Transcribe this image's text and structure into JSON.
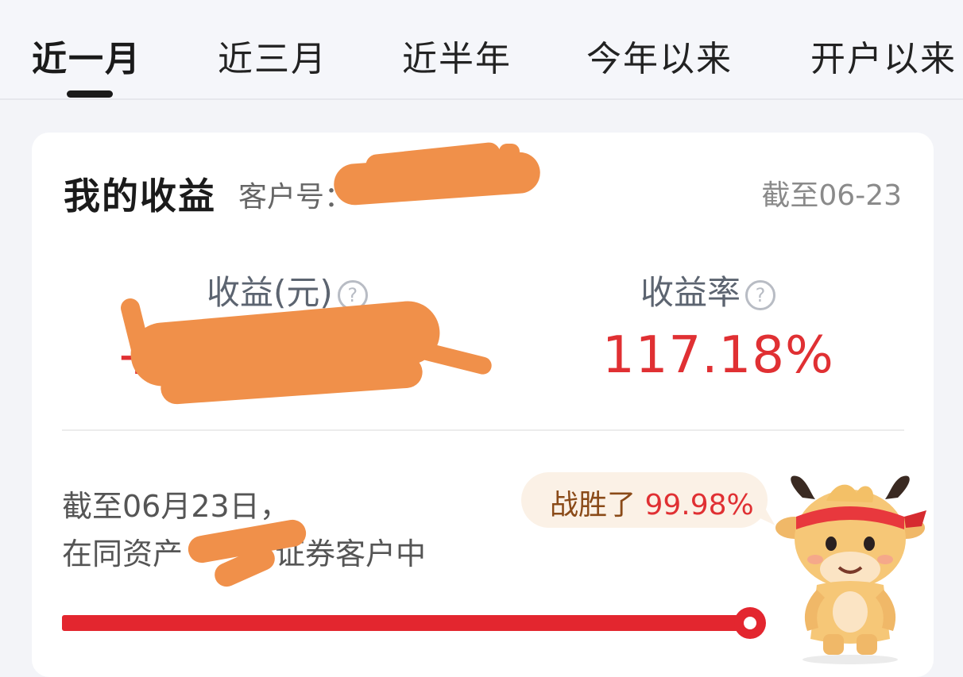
{
  "tabs": [
    {
      "label": "近一月",
      "active": true
    },
    {
      "label": "近三月",
      "active": false
    },
    {
      "label": "近半年",
      "active": false
    },
    {
      "label": "今年以来",
      "active": false
    },
    {
      "label": "开户以来",
      "active": false
    }
  ],
  "card": {
    "title": "我的收益",
    "customer_label": "客户号：",
    "as_of": "截至06-23",
    "earnings_label": "收益(元)",
    "earnings_sign": "+",
    "return_label": "收益率",
    "return_value": "117.18%",
    "rank_line1": "截至06月23日，",
    "rank_line2_prefix": "在同资产",
    "rank_line2_suffix": "证券客户中",
    "beat_prefix": "战胜了 ",
    "beat_value": "99.98%",
    "beat_fraction": 0.9998
  },
  "icons": {
    "help": "question-circle-icon",
    "mascot": "ox-mascot-icon"
  },
  "colors": {
    "accent_red": "#e3262f",
    "return_red": "#e03033",
    "redaction_orange": "#f0904a"
  }
}
